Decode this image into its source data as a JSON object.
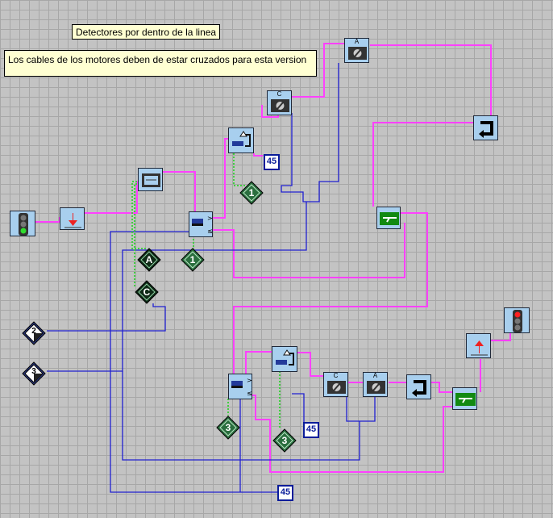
{
  "notes": {
    "title": "Detectores por dentro de la linea",
    "message": "Los cables de los motores deben de estar cruzados para esta version"
  },
  "blocks": {
    "motor_c_top": "C",
    "motor_a_top": "A",
    "motor_c_bottom": "C",
    "motor_a_bottom": "A"
  },
  "values": {
    "wait_top": "45",
    "wait_bottom": "45",
    "wait_bottom2": "45",
    "sensor_top": "1",
    "sensor_mid": "1",
    "sensor_bottom_left": "3",
    "sensor_bottom_mid": "3",
    "port_a": "A",
    "port_c": "C",
    "input_2": "2",
    "input_3": "3"
  },
  "colors": {
    "wire_blue": "#2020d0",
    "wire_pink": "#ff40ff",
    "block_fill": "#a8cfee",
    "background": "#c3c3c3"
  }
}
